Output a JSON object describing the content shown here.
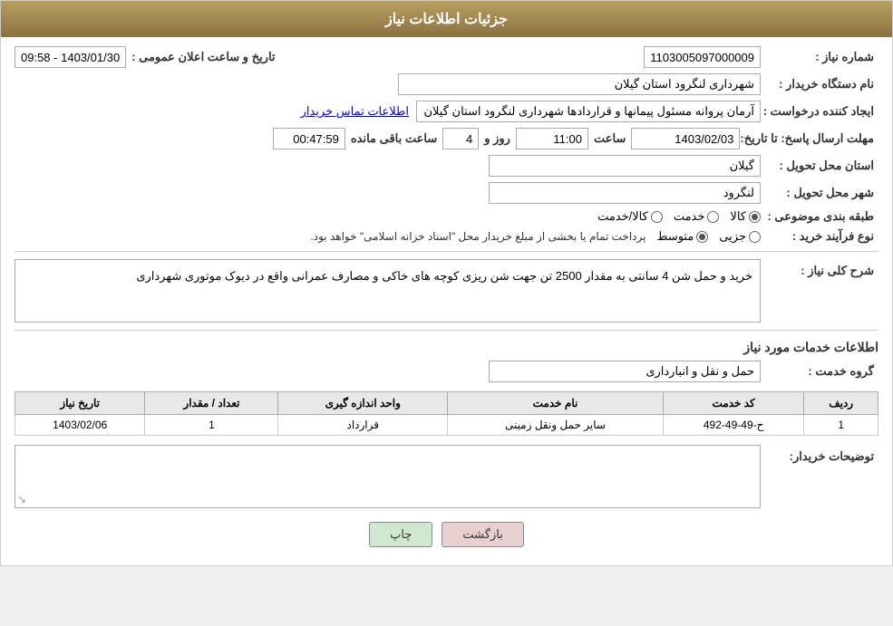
{
  "header": {
    "title": "جزئیات اطلاعات نیاز"
  },
  "fields": {
    "need_number_label": "شماره نیاز :",
    "need_number_value": "1103005097000009",
    "buyer_org_label": "نام دستگاه خریدار :",
    "buyer_org_value": "شهرداری لنگرود استان گیلان",
    "creator_label": "ایجاد کننده درخواست :",
    "creator_value": "آرمان پروانه مسئول پیمانها و قراردادها شهرداری لنگرود استان گیلان",
    "creator_link": "اطلاعات تماس خریدار",
    "announce_label": "تاریخ و ساعت اعلان عمومی :",
    "announce_value": "1403/01/30 - 09:58",
    "deadline_label": "مهلت ارسال پاسخ: تا تاریخ:",
    "deadline_date": "1403/02/03",
    "deadline_time_label": "ساعت",
    "deadline_time": "11:00",
    "deadline_days_label": "روز و",
    "deadline_days": "4",
    "deadline_remaining_label": "ساعت باقی مانده",
    "deadline_remaining": "00:47:59",
    "province_label": "استان محل تحویل :",
    "province_value": "گیلان",
    "city_label": "شهر محل تحویل :",
    "city_value": "لنگرود",
    "category_label": "طبقه بندی موضوعی :",
    "category_options": [
      {
        "label": "کالا",
        "checked": true
      },
      {
        "label": "خدمت",
        "checked": false
      },
      {
        "label": "کالا/خدمت",
        "checked": false
      }
    ],
    "purchase_type_label": "نوع فرآیند خرید :",
    "purchase_options": [
      {
        "label": "جزیی",
        "checked": false
      },
      {
        "label": "متوسط",
        "checked": true
      }
    ],
    "purchase_note": "پرداخت تمام یا بخشی از مبلغ خریدار محل \"اسناد خزانه اسلامی\" خواهد بود.",
    "description_label": "شرح کلی نیاز :",
    "description_value": "خرید و حمل شن 4 سانتی به مقدار 2500 تن جهت شن ریزی کوچه های خاکی و مصارف عمرانی واقع در دیوک موتوری شهرداری",
    "services_title": "اطلاعات خدمات مورد نیاز",
    "service_group_label": "گروه خدمت :",
    "service_group_value": "حمل و نقل و انبارداری",
    "table": {
      "columns": [
        "ردیف",
        "کد خدمت",
        "نام خدمت",
        "واحد اندازه گیری",
        "تعداد / مقدار",
        "تاریخ نیاز"
      ],
      "rows": [
        {
          "row_num": "1",
          "service_code": "ح-49-49-492",
          "service_name": "سایر حمل ونقل زمینی",
          "unit": "قرارداد",
          "quantity": "1",
          "date": "1403/02/06"
        }
      ]
    },
    "buyer_notes_label": "توضیحات خریدار:",
    "buyer_notes_value": ""
  },
  "buttons": {
    "back_label": "بازگشت",
    "print_label": "چاپ"
  }
}
